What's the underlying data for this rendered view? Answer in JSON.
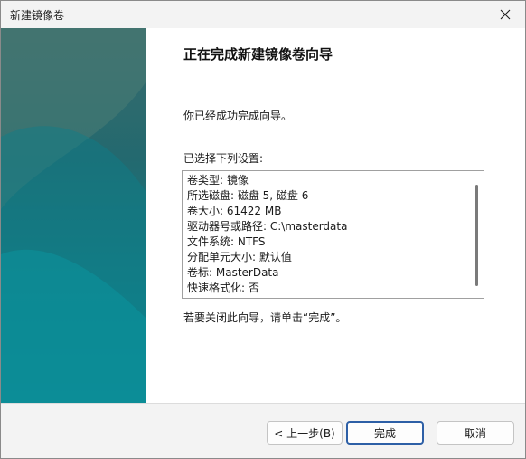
{
  "window": {
    "title": "新建镜像卷",
    "close_icon": "close-icon"
  },
  "content": {
    "heading": "正在完成新建镜像卷向导",
    "done_message": "你已经成功完成向导。",
    "settings_label": "已选择下列设置:",
    "settings": [
      "卷类型: 镜像",
      "所选磁盘: 磁盘 5, 磁盘 6",
      "卷大小: 61422 MB",
      "驱动器号或路径: C:\\masterdata",
      "文件系统: NTFS",
      "分配单元大小: 默认值",
      "卷标: MasterData",
      "快速格式化: 否"
    ],
    "close_hint": "若要关闭此向导，请单击“完成”。"
  },
  "footer": {
    "back_label": "< 上一步(B)",
    "finish_label": "完成",
    "cancel_label": "取消"
  },
  "colors": {
    "sidebar_top": "#3a6b6c",
    "sidebar_bottom": "#0f8a94",
    "default_button_border": "#2d5fa6"
  }
}
